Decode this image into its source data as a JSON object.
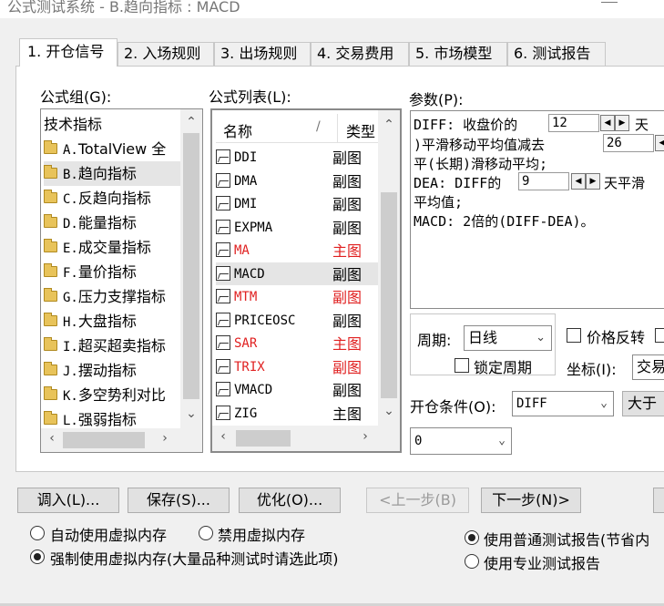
{
  "window": {
    "title": "公式测试系统 - B.趋向指标 : MACD"
  },
  "tabs": [
    "1. 开仓信号",
    "2. 入场规则",
    "3. 出场规则",
    "4. 交易费用",
    "5. 市场模型",
    "6. 测试报告"
  ],
  "formula_group": {
    "label": "公式组(G):",
    "root": "技术指标",
    "items": [
      {
        "code": "A.",
        "name": "TotalView 全"
      },
      {
        "code": "B.",
        "name": "趋向指标"
      },
      {
        "code": "C.",
        "name": "反趋向指标"
      },
      {
        "code": "D.",
        "name": "能量指标"
      },
      {
        "code": "E.",
        "name": "成交量指标"
      },
      {
        "code": "F.",
        "name": "量价指标"
      },
      {
        "code": "G.",
        "name": "压力支撑指标"
      },
      {
        "code": "H.",
        "name": "大盘指标"
      },
      {
        "code": "I.",
        "name": "超买超卖指标"
      },
      {
        "code": "J.",
        "name": "摆动指标"
      },
      {
        "code": "K.",
        "name": "多空势利对比"
      },
      {
        "code": "L.",
        "name": "强弱指标"
      }
    ]
  },
  "formula_list": {
    "label": "公式列表(L):",
    "col_name": "名称",
    "col_sort": "/",
    "col_type": "类型",
    "rows": [
      {
        "name": "DDI",
        "type": "副图"
      },
      {
        "name": "DMA",
        "type": "副图"
      },
      {
        "name": "DMI",
        "type": "副图"
      },
      {
        "name": "EXPMA",
        "type": "副图"
      },
      {
        "name": "MA",
        "type": "主图"
      },
      {
        "name": "MACD",
        "type": "副图"
      },
      {
        "name": "MTM",
        "type": "副图"
      },
      {
        "name": "PRICEOSC",
        "type": "副图"
      },
      {
        "name": "SAR",
        "type": "主图"
      },
      {
        "name": "TRIX",
        "type": "副图"
      },
      {
        "name": "VMACD",
        "type": "副图"
      },
      {
        "name": "ZIG",
        "type": "主图"
      }
    ]
  },
  "params": {
    "label": "参数(P):",
    "line1_a": "DIFF: 收盘价的",
    "p1": "12",
    "line1_b": "天",
    "line2_a": ")平滑移动平均值减去",
    "p2": "26",
    "line3": "平(长期)滑移动平均;",
    "line4_a": "DEA: DIFF的",
    "p3": "9",
    "line4_b": "天平滑",
    "line5": "平均值;",
    "line6": "MACD: 2倍的(DIFF-DEA)。"
  },
  "period": {
    "label": "周期:",
    "value": "日线"
  },
  "price_reverse": "价格反转",
  "lock_period": "锁定周期",
  "coord": {
    "label": "坐标(I):",
    "value": "交易"
  },
  "open_cond": {
    "label": "开仓条件(O):",
    "var": "DIFF",
    "op": "大于",
    "value": "0"
  },
  "buttons": {
    "load": "调入(L)...",
    "save": "保存(S)...",
    "optimize": "优化(O)...",
    "prev": "<上一步(B)",
    "next": "下一步(N)>"
  },
  "radios": {
    "auto_vm": "自动使用虚拟内存",
    "no_vm": "禁用虚拟内存",
    "force_vm": "强制使用虚拟内存(大量品种测试时请选此项)",
    "normal_report": "使用普通测试报告(节省内",
    "pro_report": "使用专业测试报告"
  }
}
